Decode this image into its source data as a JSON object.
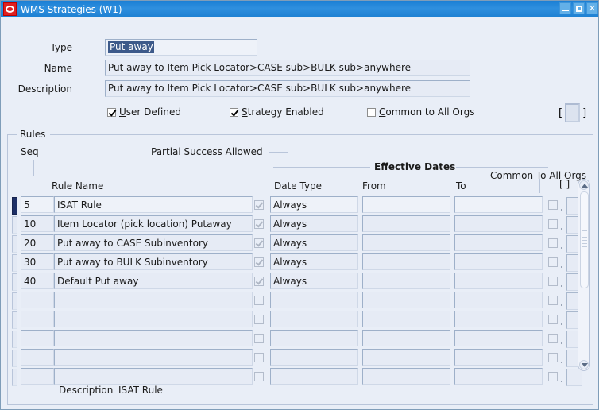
{
  "window": {
    "title": "WMS Strategies (W1)",
    "icon": "oracle-logo-icon",
    "controls": {
      "minimize": "–",
      "maximize": "□",
      "close": "✕"
    }
  },
  "header": {
    "type_label": "Type",
    "type_value": "Put away",
    "name_label": "Name",
    "name_value": "Put away to Item Pick Locator>CASE sub>BULK sub>anywhere",
    "description_label": "Description",
    "description_value": "Put away to Item Pick Locator>CASE sub>BULK sub>anywhere",
    "checkboxes": [
      {
        "label": "User Defined",
        "mnemonic": "U",
        "rest": "ser Defined",
        "checked": true
      },
      {
        "label": "Strategy Enabled",
        "mnemonic": "S",
        "rest": "trategy Enabled",
        "checked": true
      },
      {
        "label": "Common to All Orgs",
        "mnemonic": "C",
        "rest": "ommon to All Orgs",
        "checked": false
      }
    ],
    "flag_button": {
      "open_bracket": "[",
      "close_bracket": "]"
    }
  },
  "rules": {
    "group_title": "Rules",
    "headers": {
      "seq": "Seq",
      "rule_name": "Rule Name",
      "partial_success": "Partial Success Allowed",
      "effective_dates": "Effective Dates",
      "date_type": "Date Type",
      "from": "From",
      "to": "To",
      "common_all_orgs": "Common To All Orgs",
      "flag_open": "[",
      "flag_close": "]"
    },
    "rows": [
      {
        "seq": "5",
        "rule_name": "ISAT Rule",
        "partial_success": true,
        "date_type": "Always",
        "from": "",
        "to": "",
        "common": false,
        "current": true
      },
      {
        "seq": "10",
        "rule_name": "Item Locator (pick location) Putaway",
        "partial_success": true,
        "date_type": "Always",
        "from": "",
        "to": "",
        "common": false,
        "current": false
      },
      {
        "seq": "20",
        "rule_name": "Put away to CASE Subinventory",
        "partial_success": true,
        "date_type": "Always",
        "from": "",
        "to": "",
        "common": false,
        "current": false
      },
      {
        "seq": "30",
        "rule_name": "Put away to BULK Subinventory",
        "partial_success": true,
        "date_type": "Always",
        "from": "",
        "to": "",
        "common": false,
        "current": false
      },
      {
        "seq": "40",
        "rule_name": "Default Put away",
        "partial_success": true,
        "date_type": "Always",
        "from": "",
        "to": "",
        "common": false,
        "current": false
      },
      {
        "seq": "",
        "rule_name": "",
        "partial_success": false,
        "date_type": "",
        "from": "",
        "to": "",
        "common": false,
        "current": false
      },
      {
        "seq": "",
        "rule_name": "",
        "partial_success": false,
        "date_type": "",
        "from": "",
        "to": "",
        "common": false,
        "current": false
      },
      {
        "seq": "",
        "rule_name": "",
        "partial_success": false,
        "date_type": "",
        "from": "",
        "to": "",
        "common": false,
        "current": false
      },
      {
        "seq": "",
        "rule_name": "",
        "partial_success": false,
        "date_type": "",
        "from": "",
        "to": "",
        "common": false,
        "current": false
      },
      {
        "seq": "",
        "rule_name": "",
        "partial_success": false,
        "date_type": "",
        "from": "",
        "to": "",
        "common": false,
        "current": false
      }
    ]
  },
  "footer": {
    "description_label": "Description",
    "description_value": "ISAT Rule"
  }
}
